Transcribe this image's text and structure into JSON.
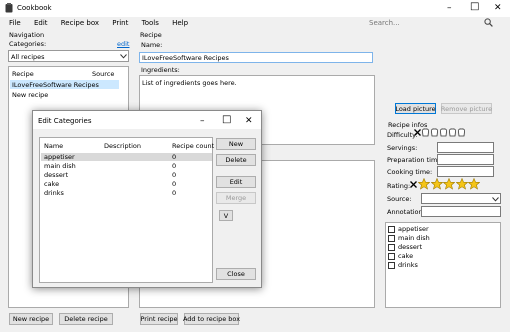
{
  "app": {
    "title": "Cookbook"
  },
  "menu": [
    "File",
    "Edit",
    "Recipe box",
    "Print",
    "Tools",
    "Help"
  ],
  "search": {
    "placeholder": "Search..."
  },
  "navigation": {
    "title": "Navigation",
    "categories_label": "Categories:",
    "edit_link": "edit",
    "selected_category": "All recipes",
    "columns": [
      "Recipe",
      "Source"
    ],
    "recipes": [
      "ILoveFreeSoftware Recipes",
      "New recipe"
    ]
  },
  "recipe": {
    "title": "Recipe",
    "name_label": "Name:",
    "name_value": "ILoveFreeSoftware Recipes",
    "ingredients_label": "Ingredients:",
    "ingredients_text": "List of ingredients goes here."
  },
  "picture": {
    "load_label": "Load picture",
    "remove_label": "Remove picture"
  },
  "infos": {
    "title": "Recipe infos",
    "difficulty_label": "Difficulty:",
    "servings_label": "Servings:",
    "prep_label": "Preparation time:",
    "cooking_label": "Cooking time:",
    "rating_label": "Rating:",
    "rating_value": 5,
    "rating_max": 5,
    "source_label": "Source:",
    "annotation_label": "Annotation:",
    "categories": [
      "appetiser",
      "main dish",
      "dessert",
      "cake",
      "drinks"
    ]
  },
  "bottom": {
    "new_recipe": "New recipe",
    "delete_recipe": "Delete recipe",
    "print_recipe": "Print recipe",
    "add_to_box": "Add to recipe box"
  },
  "dialog": {
    "title": "Edit Categories",
    "columns": [
      "Name",
      "Description",
      "Recipe count"
    ],
    "rows": [
      {
        "name": "appetiser",
        "count": "0"
      },
      {
        "name": "main dish",
        "count": "0"
      },
      {
        "name": "dessert",
        "count": "0"
      },
      {
        "name": "cake",
        "count": "0"
      },
      {
        "name": "drinks",
        "count": "0"
      }
    ],
    "buttons": {
      "new": "New",
      "delete": "Delete",
      "edit": "Edit",
      "merge": "Merge",
      "down": "V",
      "close": "Close"
    }
  },
  "colors": {
    "selection": "#cce8ff",
    "star": "#f5c518",
    "focus": "#0078d7"
  }
}
